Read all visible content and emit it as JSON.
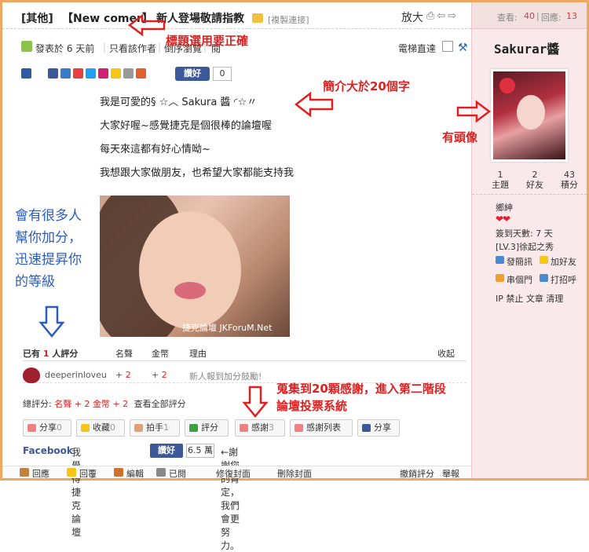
{
  "header": {
    "category": "[其他]",
    "tag": "【New comer】",
    "title": "新人登場敬請指教",
    "copy_link": "[複製連接]",
    "zoom": "放大"
  },
  "meta": {
    "posted": "發表於 6 天前",
    "only_author": "只看該作者",
    "reverse": "倒序瀏覽",
    "read": "閱",
    "elevator": "電梯直達"
  },
  "share": {
    "like": "讚好",
    "like_count": "0"
  },
  "post": {
    "lines": [
      "我是可愛的§ ☆︿ Sakura 醬 ◜☆〃",
      "大家好喔~感覺捷克是個很棒的論壇喔",
      "每天來這都有好心情呦~",
      "我想跟大家做朋友，也希望大家都能支持我"
    ],
    "photo_watermark": "捷克論壇 JKForuM.Net"
  },
  "annotations": {
    "title_tip": "標題選用要正確",
    "intro_tip": "簡介大於20個字",
    "avatar_tip": "有頭像",
    "rate_tip": "會有很多人幫你加分，迅速提昇你的等級",
    "thanks_tip_1": "蒐集到20顆感謝，進入第二階段",
    "thanks_tip_2": "論壇投票系統"
  },
  "rating": {
    "header_prefix": "已有",
    "header_count": "1",
    "header_suffix": "人評分",
    "col_fame": "名聲",
    "col_gold": "金幣",
    "col_reason": "理由",
    "collapse": "收起",
    "rows": [
      {
        "user": "deeperinloveu",
        "fame": "+ 2",
        "gold": "+ 2",
        "reason": "新人報到加分鼓勵!"
      }
    ],
    "total_label": "總評分:",
    "total_fame": "名聲 + 2",
    "total_gold": "金幣 + 2",
    "view_all": "查看全部評分"
  },
  "actions": [
    {
      "label": "分享",
      "count": "0"
    },
    {
      "label": "收藏",
      "count": "0"
    },
    {
      "label": "拍手",
      "count": "1"
    },
    {
      "label": "評分",
      "count": ""
    },
    {
      "label": "感謝",
      "count": "3"
    },
    {
      "label": "感謝列表",
      "count": ""
    },
    {
      "label": "分享",
      "count": ""
    }
  ],
  "facebook": {
    "brand": "Facebook",
    "text": "我覺得捷克論壇",
    "like": "讚好",
    "count": "6.5 萬",
    "note": "←謝謝您的肯定，我們會更努力。"
  },
  "bottom": {
    "reply": "回應",
    "reply2": "回覆",
    "edit": "編輯",
    "read": "已閱",
    "fix_cover": "修復封面",
    "remove_cover": "刪除封面",
    "revoke_rating": "撤銷評分",
    "report": "舉報"
  },
  "sidebar": {
    "views_label": "查看:",
    "views": "40",
    "replies_label": "回應:",
    "replies": "13",
    "username": "Sakurar醬",
    "counts": [
      {
        "num": "1",
        "label": "主題"
      },
      {
        "num": "2",
        "label": "好友"
      },
      {
        "num": "43",
        "label": "積分"
      }
    ],
    "rank": "鄉紳",
    "hearts": "❤❤",
    "checkin": "簽到天數: 7 天",
    "level": "[LV.3]徐起之秀",
    "send_msg": "發簡訊",
    "add_friend": "加好友",
    "single_door": "串個門",
    "greet": "打招呼",
    "admin_links": "IP 禁止 文章 清理"
  },
  "colors": {
    "annotation_red": "#e02020",
    "annotation_blue": "#2b5dbd",
    "frame_orange": "#f0a860",
    "sidebar_pink": "#f9e9ea",
    "facebook_blue": "#3b5998"
  }
}
